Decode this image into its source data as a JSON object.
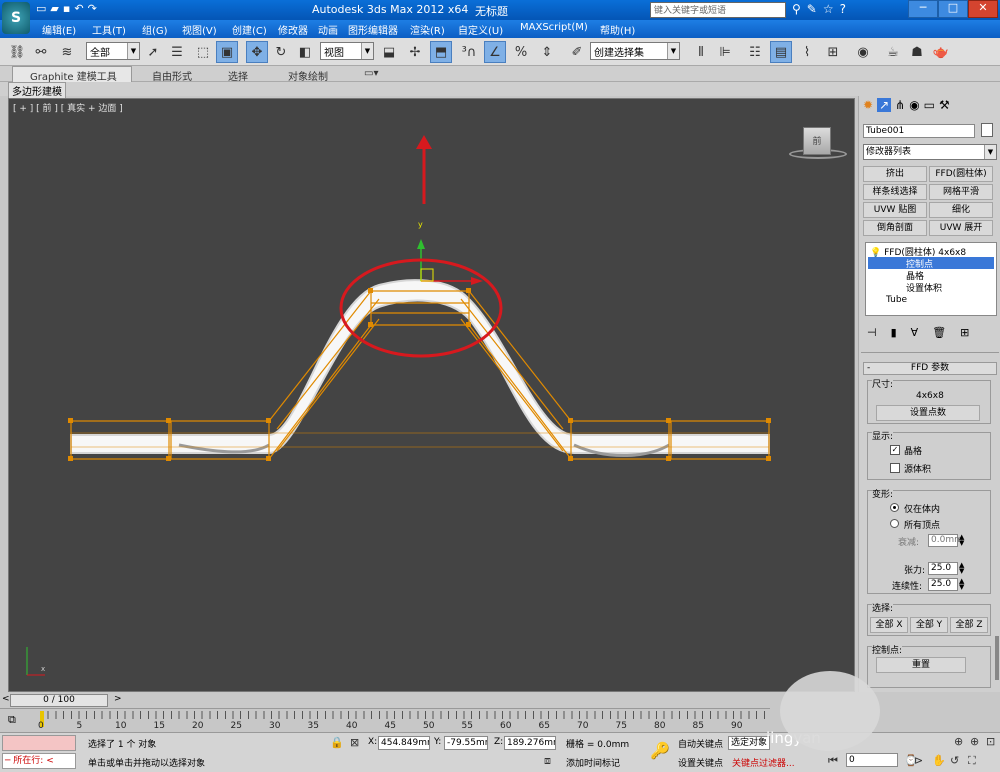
{
  "titlebar": {
    "app_title": "Autodesk 3ds Max  2012 x64",
    "doc_title": "无标题",
    "search_placeholder": "键入关键字或短语"
  },
  "menu": [
    "编辑(E)",
    "工具(T)",
    "组(G)",
    "视图(V)",
    "创建(C)",
    "修改器",
    "动画",
    "图形编辑器",
    "渲染(R)",
    "自定义(U)",
    "MAXScript(M)",
    "帮助(H)"
  ],
  "toolbar": {
    "selection_filter": "全部",
    "ref_coord": "视图",
    "named_selection": "创建选择集"
  },
  "ribbon": {
    "tabs": [
      "Graphite 建模工具",
      "自由形式",
      "选择",
      "对象绘制"
    ],
    "subtitle": "多边形建模"
  },
  "viewport": {
    "label": "[ + ] [ 前 ] [ 真实 + 边面 ]",
    "viewcube_label": "前",
    "axis_y": "y",
    "axis_x": "x"
  },
  "command_panel": {
    "object_name": "Tube001",
    "modifier_list": "修改器列表",
    "modifier_buttons": [
      "挤出",
      "FFD(圆柱体)",
      "样条线选择",
      "网格平滑",
      "UVW 贴图",
      "细化",
      "倒角剖面",
      "UVW 展开"
    ],
    "stack": {
      "modifier": "FFD(圆柱体) 4x6x8",
      "subitems": [
        "控制点",
        "晶格",
        "设置体积"
      ],
      "base": "Tube"
    },
    "rollout_title": "FFD 参数",
    "size_group": "尺寸:",
    "size_value": "4x6x8",
    "set_points_button": "设置点数",
    "display_group": "显示:",
    "lattice_checkbox": "晶格",
    "source_volume_checkbox": "源体积",
    "deform_group": "变形:",
    "radio_inside": "仅在体内",
    "radio_all": "所有顶点",
    "falloff_label": "衰减:",
    "falloff_value": "0.0mm",
    "tension_label": "张力:",
    "tension_value": "25.0",
    "continuity_label": "连续性:",
    "continuity_value": "25.0",
    "select_group": "选择:",
    "select_buttons": [
      "全部 X",
      "全部 Y",
      "全部 Z"
    ],
    "control_points_group": "控制点:",
    "reset_button": "重置"
  },
  "timeline": {
    "frame_display": "0 / 100",
    "ticks": [
      "0",
      "5",
      "10",
      "15",
      "20",
      "25",
      "30",
      "35",
      "40",
      "45",
      "50",
      "55",
      "60",
      "65",
      "70",
      "75",
      "80",
      "85",
      "90"
    ]
  },
  "status": {
    "current_action": "所在行:",
    "selection_info": "选择了 1 个 对象",
    "prompt": "单击或单击并拖动以选择对象",
    "x_label": "X:",
    "x_value": "454.849mr",
    "y_label": "Y:",
    "y_value": "-79.55mm",
    "z_label": "Z:",
    "z_value": "189.276mr",
    "grid": "栅格 = 0.0mm",
    "add_time_tag": "添加时间标记",
    "auto_key": "自动关键点",
    "set_key": "设置关键点",
    "selected_object": "选定对象",
    "key_filters": "关键点过滤器...",
    "frame_field": "0",
    "watermark": "jingyan"
  },
  "colors": {
    "title_blue": "#0a6fd8",
    "viewport_bg": "#444444",
    "lattice_orange": "#e08a00",
    "annotation_red": "#d7191e",
    "selection_blue": "#3a78d8"
  }
}
